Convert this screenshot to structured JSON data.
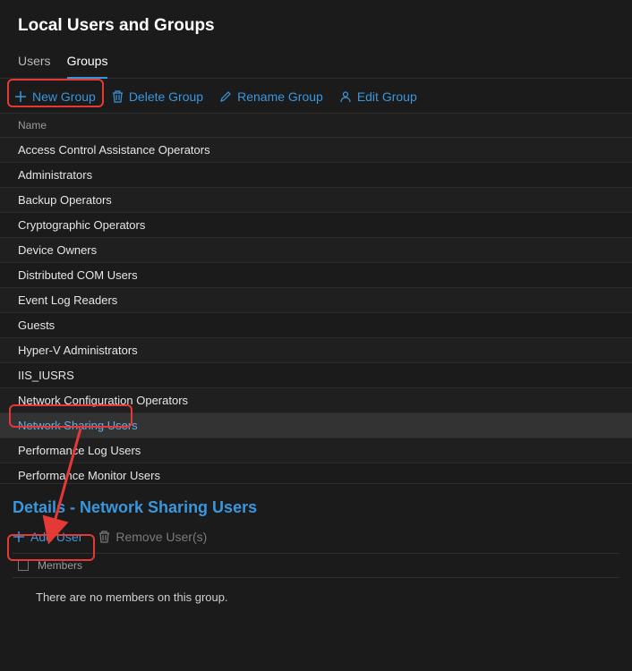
{
  "page": {
    "title": "Local Users and Groups"
  },
  "tabs": [
    {
      "label": "Users",
      "active": false
    },
    {
      "label": "Groups",
      "active": true
    }
  ],
  "toolbar": {
    "newGroup": "New Group",
    "deleteGroup": "Delete Group",
    "renameGroup": "Rename Group",
    "editGroup": "Edit Group"
  },
  "columnHeader": "Name",
  "groups": [
    "Access Control Assistance Operators",
    "Administrators",
    "Backup Operators",
    "Cryptographic Operators",
    "Device Owners",
    "Distributed COM Users",
    "Event Log Readers",
    "Guests",
    "Hyper-V Administrators",
    "IIS_IUSRS",
    "Network Configuration Operators",
    "Network Sharing Users",
    "Performance Log Users",
    "Performance Monitor Users"
  ],
  "selectedGroupIndex": 11,
  "details": {
    "titlePrefix": "Details - ",
    "titleName": "Network Sharing Users",
    "addUser": "Add User",
    "removeUsers": "Remove User(s)",
    "membersHeader": "Members",
    "emptyMessage": "There are no members on this group."
  }
}
